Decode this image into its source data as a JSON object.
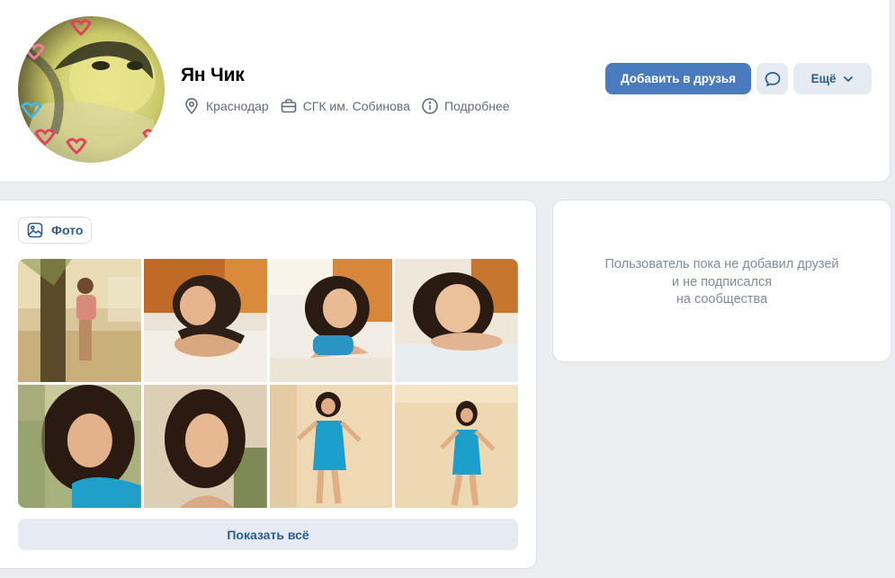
{
  "profile": {
    "name": "Ян Чик",
    "city": "Краснодар",
    "education": "СГК им. Собинова",
    "more_info": "Подробнее"
  },
  "actions": {
    "add_friend": "Добавить в друзья",
    "more": "Ещё"
  },
  "photos": {
    "tab_label": "Фото",
    "show_all": "Показать всё",
    "count_visible": 8
  },
  "friends": {
    "empty_line1": "Пользователь пока не добавил друзей",
    "empty_line2": "и не подписался",
    "empty_line3": "на сообщества"
  },
  "colors": {
    "accent": "#4a7bbf",
    "secondary_button": "#e5ebf1",
    "link": "#2c5b8e",
    "muted_text": "#626d7a",
    "page_bg": "#ebedf0"
  },
  "icons": {
    "city": "location-pin-icon",
    "education": "briefcase-icon",
    "more_info": "info-circle-icon",
    "message": "message-bubble-icon",
    "more": "chevron-down-icon",
    "photo_tab": "image-icon"
  }
}
